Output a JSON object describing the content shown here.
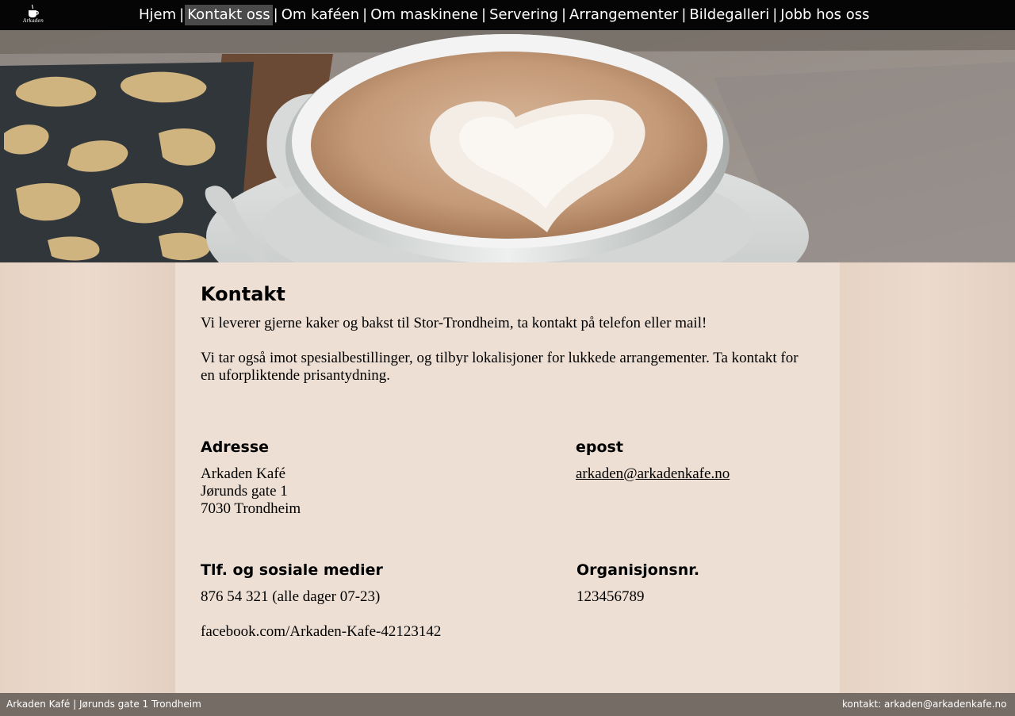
{
  "nav": {
    "logo_text": "Arkaden",
    "items": [
      {
        "label": "Hjem",
        "active": false
      },
      {
        "label": "Kontakt oss",
        "active": true
      },
      {
        "label": "Om kaféen",
        "active": false
      },
      {
        "label": "Om maskinene",
        "active": false
      },
      {
        "label": "Servering",
        "active": false
      },
      {
        "label": "Arrangementer",
        "active": false
      },
      {
        "label": "Bildegalleri",
        "active": false
      },
      {
        "label": "Jobb hos oss",
        "active": false
      }
    ],
    "separator": "|"
  },
  "content": {
    "title": "Kontakt",
    "intro": [
      "Vi leverer gjerne kaker og bakst til Stor-Trondheim, ta kontakt på telefon eller mail!",
      "Vi tar også imot spesialbestillinger, og tilbyr lokalisjoner for lukkede arrangementer. Ta kontakt for en uforpliktende prisantydning."
    ],
    "address": {
      "heading": "Adresse",
      "line1": "Arkaden Kafé",
      "line2": "Jørunds gate 1",
      "line3": "7030 Trondheim"
    },
    "email": {
      "heading": "epost",
      "address": "arkaden@arkadenkafe.no"
    },
    "phone": {
      "heading": "Tlf. og sosiale medier",
      "phone": "876 54 321 (alle dager 07-23)",
      "facebook": "facebook.com/Arkaden-Kafe-42123142"
    },
    "org": {
      "heading": "Organisjonsnr.",
      "number": "123456789"
    }
  },
  "footer": {
    "left": "Arkaden Kafé | Jørunds gate 1 Trondheim",
    "right": "kontakt: arkaden@arkadenkafe.no"
  }
}
